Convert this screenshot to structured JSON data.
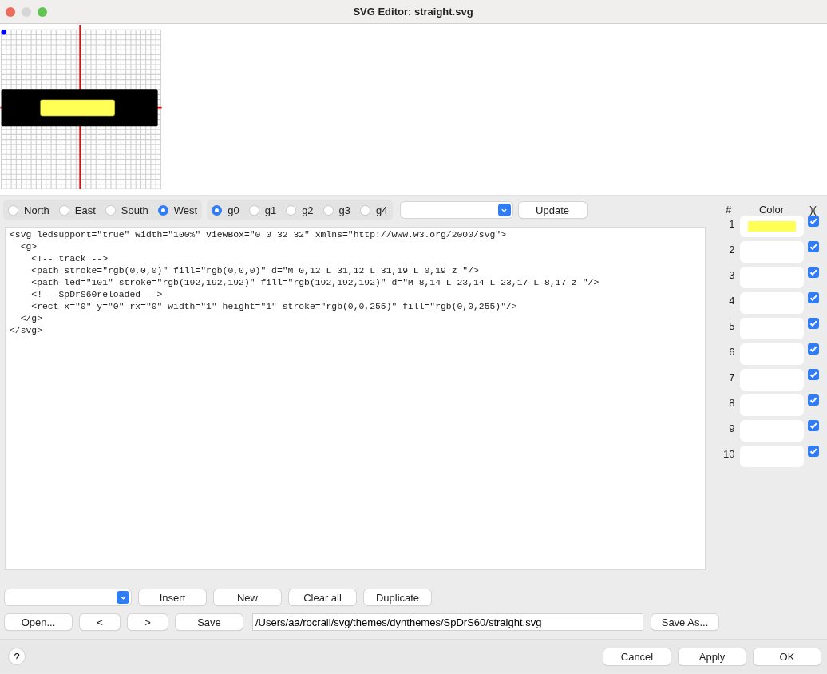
{
  "window": {
    "title": "SVG Editor: straight.svg"
  },
  "directions": [
    {
      "label": "North",
      "selected": false
    },
    {
      "label": "East",
      "selected": false
    },
    {
      "label": "South",
      "selected": false
    },
    {
      "label": "West",
      "selected": true
    }
  ],
  "groups": [
    {
      "label": "g0",
      "selected": true
    },
    {
      "label": "g1",
      "selected": false
    },
    {
      "label": "g2",
      "selected": false
    },
    {
      "label": "g3",
      "selected": false
    },
    {
      "label": "g4",
      "selected": false
    }
  ],
  "update_button": "Update",
  "code_lines": [
    "<svg ledsupport=\"true\" width=\"100%\" viewBox=\"0 0 32 32\" xmlns=\"http://www.w3.org/2000/svg\">",
    "  <g>",
    "    <!-- track -->",
    "    <path stroke=\"rgb(0,0,0)\" fill=\"rgb(0,0,0)\" d=\"M 0,12 L 31,12 L 31,19 L 0,19 z \"/>",
    "    <path led=\"101\" stroke=\"rgb(192,192,192)\" fill=\"rgb(192,192,192)\" d=\"M 8,14 L 23,14 L 23,17 L 8,17 z \"/>",
    "    <!-- SpDrS60reloaded -->",
    "    <rect x=\"0\" y=\"0\" rx=\"0\" width=\"1\" height=\"1\" stroke=\"rgb(0,0,255)\" fill=\"rgb(0,0,255)\"/>",
    "  </g>",
    "</svg>"
  ],
  "color_table": {
    "columns": [
      "#",
      "Color",
      ")("
    ],
    "rows": [
      {
        "number": "1",
        "color": "#ffff55",
        "checked": true
      },
      {
        "number": "2",
        "checked": true
      },
      {
        "number": "3",
        "checked": true
      },
      {
        "number": "4",
        "checked": true
      },
      {
        "number": "5",
        "checked": true
      },
      {
        "number": "6",
        "checked": true
      },
      {
        "number": "7",
        "checked": true
      },
      {
        "number": "8",
        "checked": true
      },
      {
        "number": "9",
        "checked": true
      },
      {
        "number": "10",
        "checked": true
      }
    ]
  },
  "edit_buttons": [
    "Insert",
    "New",
    "Clear all",
    "Duplicate"
  ],
  "file_buttons": [
    "Open...",
    "<",
    ">",
    "Save"
  ],
  "file_path": "/Users/aa/rocrail/svg/themes/dynthemes/SpDrS60/straight.svg",
  "save_as_button": "Save As...",
  "help_button": "?",
  "dialog_buttons": [
    "Cancel",
    "Apply",
    "OK"
  ]
}
